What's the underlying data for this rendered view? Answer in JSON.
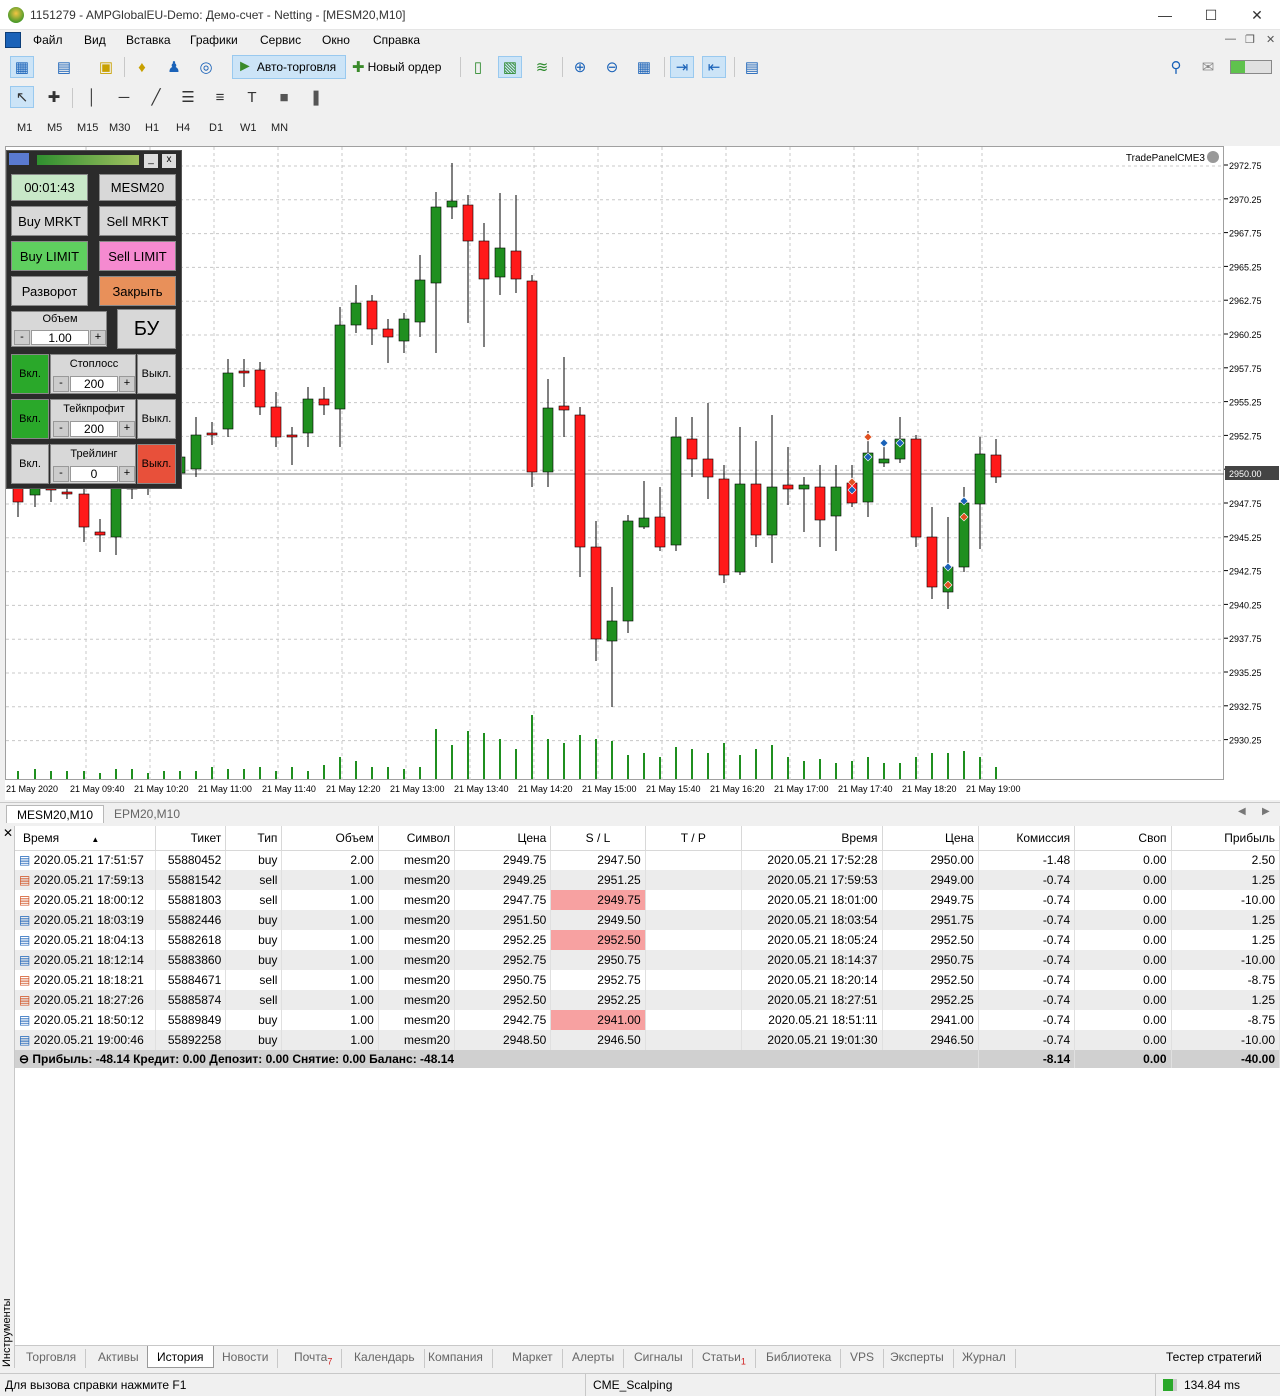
{
  "window": {
    "title": "1151279 - AMPGlobalEU-Demo: Демо-счет - Netting - [MESM20,M10]"
  },
  "menu": [
    "Файл",
    "Вид",
    "Вставка",
    "Графики",
    "Сервис",
    "Окно",
    "Справка"
  ],
  "toolbar": {
    "autotrade": "Авто-торговля",
    "new_order": "Новый ордер"
  },
  "timeframes": [
    "M1",
    "M5",
    "M15",
    "M30",
    "H1",
    "H4",
    "D1",
    "W1",
    "MN"
  ],
  "chart": {
    "indicator": "TradePanelCME3",
    "current_price": "2950.00",
    "price_ticks": [
      "2972.75",
      "2970.25",
      "2967.75",
      "2965.25",
      "2962.75",
      "2960.25",
      "2957.75",
      "2955.25",
      "2952.75",
      "2950.00",
      "2947.75",
      "2945.25",
      "2942.75",
      "2940.25",
      "2937.75",
      "2935.25",
      "2932.75",
      "2930.25"
    ],
    "time_ticks": [
      "21 May 2020",
      "21 May 09:40",
      "21 May 10:20",
      "21 May 11:00",
      "21 May 11:40",
      "21 May 12:20",
      "21 May 13:00",
      "21 May 13:40",
      "21 May 14:20",
      "21 May 15:00",
      "21 May 15:40",
      "21 May 16:20",
      "21 May 17:00",
      "21 May 17:40",
      "21 May 18:20",
      "21 May 19:00"
    ],
    "tabs": [
      "MESM20,M10",
      "EPM20,M10"
    ]
  },
  "panel": {
    "timer": "00:01:43",
    "symbol": "MESM20",
    "buy_mrkt": "Buy MRKT",
    "sell_mrkt": "Sell MRKT",
    "buy_limit": "Buy LIMIT",
    "sell_limit": "Sell LIMIT",
    "reverse": "Разворот",
    "close": "Закрыть",
    "volume_label": "Объем",
    "volume": "1.00",
    "be": "БУ",
    "on": "Вкл.",
    "off": "Выкл.",
    "minus": "-",
    "plus": "+",
    "sl_label": "Стоплосс",
    "sl": "200",
    "tp_label": "Тейкпрофит",
    "tp": "200",
    "trail_label": "Трейлинг",
    "trail": "0",
    "close_x": "x",
    "min": "_"
  },
  "history": {
    "columns": [
      "Время",
      "Тикет",
      "Тип",
      "Объем",
      "Символ",
      "Цена",
      "S / L",
      "T / P",
      "Время",
      "Цена",
      "Комиссия",
      "Своп",
      "Прибыль"
    ],
    "rows": [
      [
        "2020.05.21 17:51:57",
        "55880452",
        "buy",
        "2.00",
        "mesm20",
        "2949.75",
        "2947.50",
        "",
        "2020.05.21 17:52:28",
        "2950.00",
        "-1.48",
        "0.00",
        "2.50"
      ],
      [
        "2020.05.21 17:59:13",
        "55881542",
        "sell",
        "1.00",
        "mesm20",
        "2949.25",
        "2951.25",
        "",
        "2020.05.21 17:59:53",
        "2949.00",
        "-0.74",
        "0.00",
        "1.25"
      ],
      [
        "2020.05.21 18:00:12",
        "55881803",
        "sell",
        "1.00",
        "mesm20",
        "2947.75",
        "2949.75",
        "",
        "2020.05.21 18:01:00",
        "2949.75",
        "-0.74",
        "0.00",
        "-10.00"
      ],
      [
        "2020.05.21 18:03:19",
        "55882446",
        "buy",
        "1.00",
        "mesm20",
        "2951.50",
        "2949.50",
        "",
        "2020.05.21 18:03:54",
        "2951.75",
        "-0.74",
        "0.00",
        "1.25"
      ],
      [
        "2020.05.21 18:04:13",
        "55882618",
        "buy",
        "1.00",
        "mesm20",
        "2952.25",
        "2952.50",
        "",
        "2020.05.21 18:05:24",
        "2952.50",
        "-0.74",
        "0.00",
        "1.25"
      ],
      [
        "2020.05.21 18:12:14",
        "55883860",
        "buy",
        "1.00",
        "mesm20",
        "2952.75",
        "2950.75",
        "",
        "2020.05.21 18:14:37",
        "2950.75",
        "-0.74",
        "0.00",
        "-10.00"
      ],
      [
        "2020.05.21 18:18:21",
        "55884671",
        "sell",
        "1.00",
        "mesm20",
        "2950.75",
        "2952.75",
        "",
        "2020.05.21 18:20:14",
        "2952.50",
        "-0.74",
        "0.00",
        "-8.75"
      ],
      [
        "2020.05.21 18:27:26",
        "55885874",
        "sell",
        "1.00",
        "mesm20",
        "2952.50",
        "2952.25",
        "",
        "2020.05.21 18:27:51",
        "2952.25",
        "-0.74",
        "0.00",
        "1.25"
      ],
      [
        "2020.05.21 18:50:12",
        "55889849",
        "buy",
        "1.00",
        "mesm20",
        "2942.75",
        "2941.00",
        "",
        "2020.05.21 18:51:11",
        "2941.00",
        "-0.74",
        "0.00",
        "-8.75"
      ],
      [
        "2020.05.21 19:00:46",
        "55892258",
        "buy",
        "1.00",
        "mesm20",
        "2948.50",
        "2946.50",
        "",
        "2020.05.21 19:01:30",
        "2946.50",
        "-0.74",
        "0.00",
        "-10.00"
      ]
    ],
    "highlight_sl": [
      2,
      4,
      5,
      7,
      8,
      9
    ],
    "summary": {
      "text": "Прибыль: -48.14  Кредит: 0.00  Депозит: 0.00  Снятие: 0.00  Баланс: -48.14",
      "commission": "-8.14",
      "swap": "0.00",
      "profit": "-40.00"
    }
  },
  "bottom_tabs": [
    "Торговля",
    "Активы",
    "История",
    "Новости",
    "Почта",
    "Календарь",
    "Компания",
    "Маркет",
    "Алерты",
    "Сигналы",
    "Статьи",
    "Библиотека",
    "VPS",
    "Эксперты",
    "Журнал"
  ],
  "mail_badge": "7",
  "articles_badge": "1",
  "strategy_tester": "Тестер стратегий",
  "side_label": "Инструменты",
  "status": {
    "help": "Для вызова справки нажмите F1",
    "profile": "CME_Scalping",
    "ping": "134.84 ms"
  }
}
